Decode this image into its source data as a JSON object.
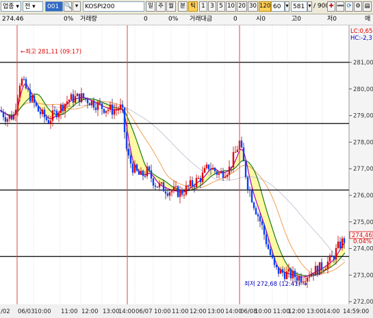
{
  "toolbar": {
    "category": "업종",
    "market": "전",
    "code": "001",
    "name": "KOSPI200",
    "periods": [
      "일",
      "주",
      "월",
      "분",
      "틱"
    ],
    "active_period": "틱",
    "minutes": [
      "1",
      "3",
      "5",
      "10",
      "20",
      "30",
      "120"
    ],
    "active_minute": "120",
    "interval_value": "60",
    "count_value": "581",
    "count_total": "/ 900"
  },
  "info_bar": {
    "price": "274.46",
    "price_pct": "0%",
    "volume_label": "거래량",
    "volume_value": "0",
    "volume_pct": "0%",
    "amount_label": "거래대금",
    "amount_value": "0",
    "open_label": "시0",
    "high_label": "고0",
    "low_label": "저0",
    "end_label": "매"
  },
  "chart_data": {
    "type": "candlestick",
    "y_ticks": [
      "281,00",
      "280,00",
      "279,00",
      "278,00",
      "277,00",
      "276,00",
      "275,00",
      "274,00",
      "273,00",
      "272,00"
    ],
    "x_labels": [
      "/02",
      "06/03",
      "10:00",
      "11:00",
      "12:00",
      "13:00",
      "14:00",
      "06/07",
      "10:00",
      "11:00",
      "12:00",
      "13:00",
      "14:00",
      "06/08",
      "10:00",
      "11:00",
      "12:00",
      "13:00",
      "14:00",
      "14:59:00"
    ],
    "current_price": "274,46",
    "current_change": "0.04%",
    "high_annotation": "←최고 281,11 (09:17)",
    "low_annotation": "최저 272,68 (12:41) →",
    "lc_label": "LC:0,65",
    "hc_label": "HC:-2,3",
    "h_lines": [
      281.0,
      278.7,
      276.2,
      273.7
    ],
    "day_dividers": [
      "06/03",
      "06/07",
      "06/08"
    ]
  }
}
